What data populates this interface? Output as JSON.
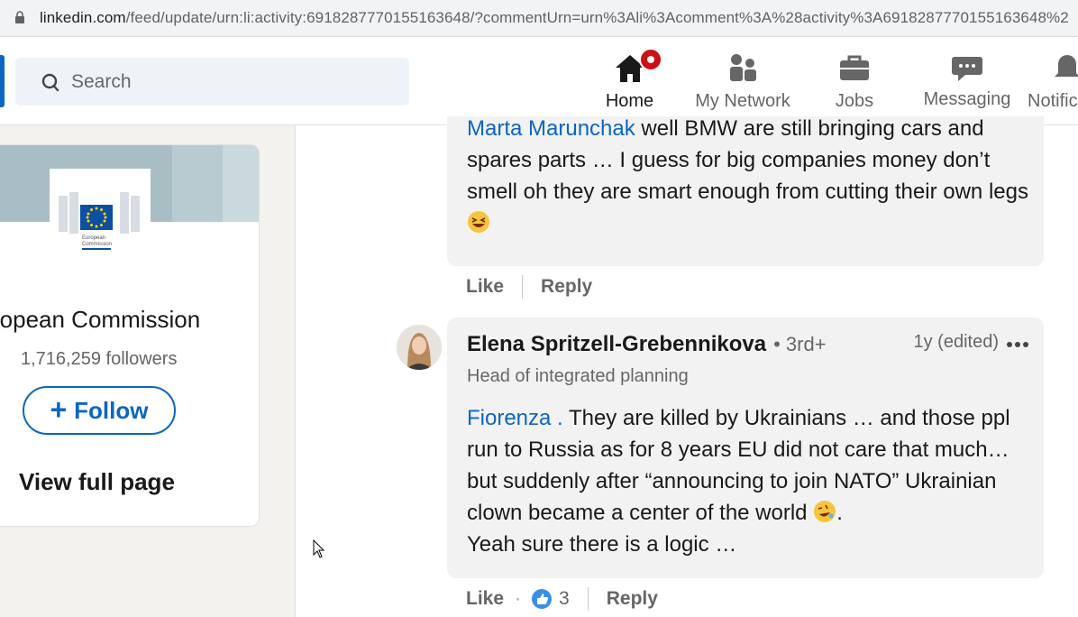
{
  "browser": {
    "url_host": "linkedin.com",
    "url_path": "/feed/update/urn:li:activity:6918287770155163648/?commentUrn=urn%3Ali%3Acomment%3A%28activity%3A6918287770155163648%2"
  },
  "header": {
    "search_placeholder": "Search",
    "nav": [
      {
        "label": "Home",
        "icon": "home-icon",
        "active": true
      },
      {
        "label": "My Network",
        "icon": "network-icon"
      },
      {
        "label": "Jobs",
        "icon": "briefcase-icon"
      },
      {
        "label": "Messaging",
        "icon": "messaging-icon"
      },
      {
        "label": "Notific",
        "icon": "bell-icon"
      }
    ]
  },
  "org_card": {
    "name": "ropean Commission",
    "followers": "1,716,259 followers",
    "follow_plus": "+",
    "follow_label": "Follow",
    "view_full": "View full page",
    "logo_text_1": "European",
    "logo_text_2": "Commission"
  },
  "comments": [
    {
      "mention": "Marta Marunchak",
      "text": " well BMW are still bringing cars and spares parts … I guess for big companies money don’t smell oh they are smart enough from cutting their own legs ",
      "like": "Like",
      "reply": "Reply"
    },
    {
      "author": "Elena Spritzell-Grebennikova",
      "degree": "• 3rd+",
      "headline": "Head of integrated planning",
      "time": "1y (edited)",
      "mention": "Fiorenza .",
      "text": " They are killed by Ukrainians … and those ppl run to Russia as for 8 years EU did not care that much… but suddenly after “announcing to join NATO” Ukrainian clown became a center of the world ",
      "text_end": ".",
      "text_line2": "Yeah sure there is a logic …",
      "like": "Like",
      "dot": "·",
      "reactions": "3",
      "reply": "Reply"
    }
  ],
  "colors": {
    "accent": "#0a66c2",
    "badge": "#cc1016"
  }
}
